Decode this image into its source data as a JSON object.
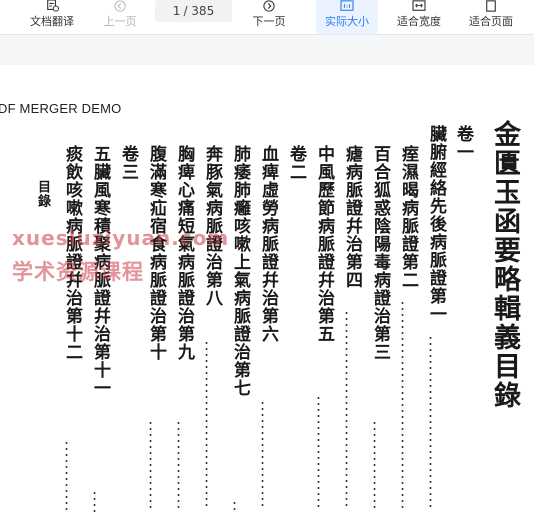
{
  "toolbar": {
    "translate_label": "文档翻译",
    "prev_label": "上一页",
    "page_current": "1",
    "page_total": "/ 385",
    "next_label": "下一页",
    "actual_size_label": "实际大小",
    "fit_width_label": "适合宽度",
    "fit_page_label": "适合页面"
  },
  "document": {
    "banner": "DF MERGER DEMO",
    "title": "金匱玉函要略輯義目錄",
    "columns": [
      "卷一",
      "臟腑經絡先後病脈證第一",
      "痓濕暍病脈證第二",
      "百合狐惑陰陽毒病證治第三",
      "瘧病脈證幷治第四",
      "中風歷節病脈證幷治第五",
      "卷二",
      "血痺虛勞病脈證幷治第六",
      "肺痿肺癰咳嗽上氣病脈證治第七",
      "奔豚氣病脈證治第八",
      "胸痺心痛短氣病脈證治第九",
      "腹滿寒疝宿食病脈證治第十",
      "卷三",
      "五臟風寒積聚病脈證幷治第十一",
      "痰飲咳嗽病脈證幷治第十二"
    ],
    "side_label": "目錄"
  },
  "watermark": {
    "line1": "xuesluziyuan.com",
    "line2": "学术资源课程"
  }
}
